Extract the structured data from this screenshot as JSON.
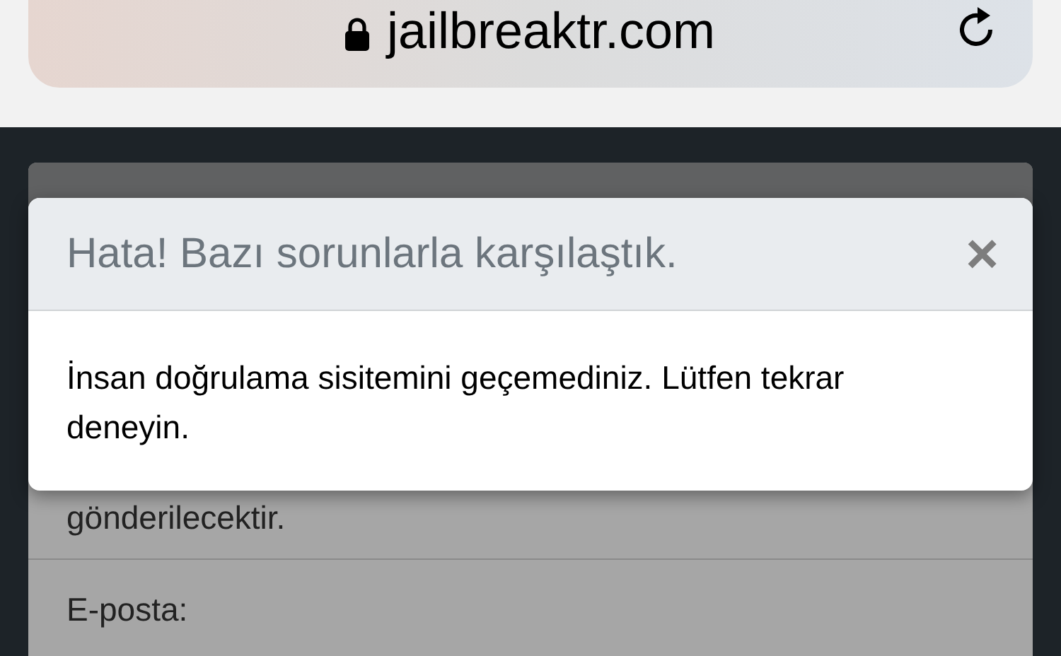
{
  "browser": {
    "url": "jailbreaktr.com"
  },
  "background_form": {
    "text": "gönderilecektir.",
    "field_label": "E-posta:"
  },
  "alert": {
    "title": "Hata! Bazı sorunlarla karşılaştık.",
    "close": "×",
    "message": "İnsan doğrulama sisitemini geçemediniz. Lütfen tekrar deneyin."
  }
}
